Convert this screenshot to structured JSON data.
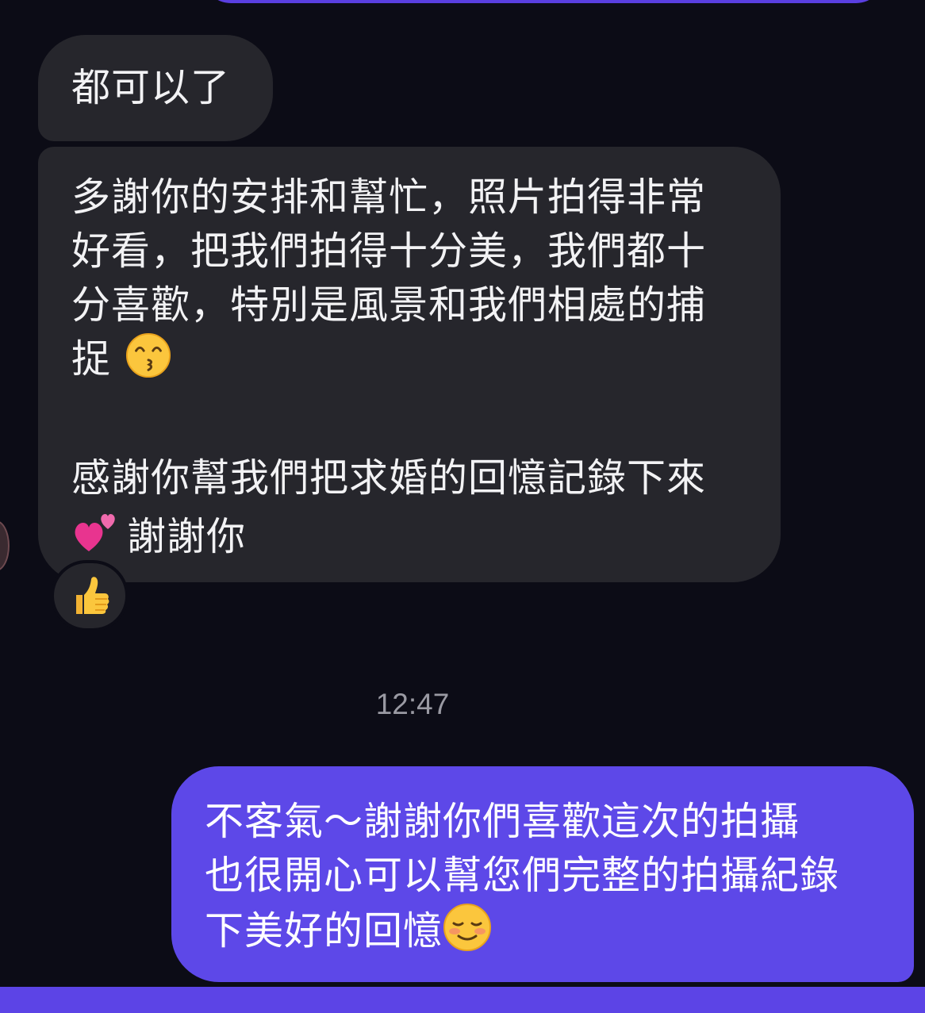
{
  "messages": {
    "incoming_short": {
      "text": "都可以了"
    },
    "incoming_long": {
      "lines": [
        "多謝你的安排和幫忙，照片拍得非常",
        "好看，把我們拍得十分美，我們都十",
        "分喜歡，特別是風景和我們相處的捕",
        "捉"
      ],
      "emoji_1": "kissing-smiling-eyes-emoji",
      "line_5": "感謝你幫我們把求婚的回憶記錄下來",
      "emoji_2": "two-hearts-emoji",
      "line_6": "謝謝你",
      "reaction": "thumbs-up-emoji"
    },
    "timestamp": "12:47",
    "outgoing": {
      "lines": [
        "不客氣～謝謝你們喜歡這次的拍攝",
        "也很開心可以幫您們完整的拍攝紀錄",
        "下美好的回憶"
      ],
      "emoji": "smiling-face-emoji"
    }
  },
  "colors": {
    "background": "#0c0c16",
    "incoming_bubble": "#26262c",
    "outgoing_bubble": "#5d48e8",
    "timestamp_text": "#9a9aa3"
  }
}
